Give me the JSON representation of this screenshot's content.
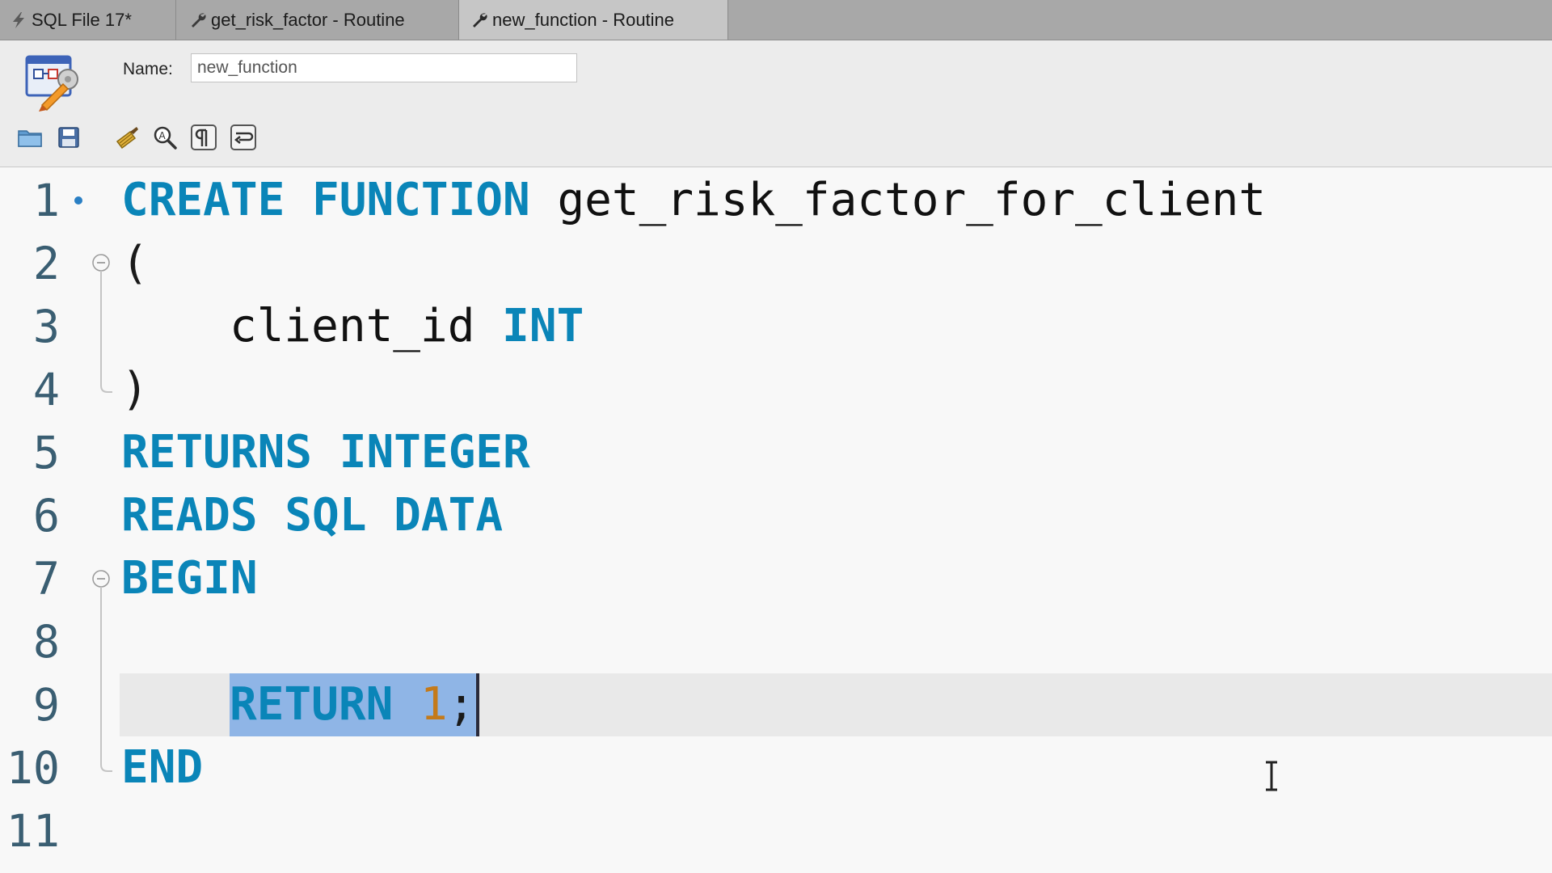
{
  "tabs": [
    {
      "label": "SQL File 17*",
      "icon": "lightning-icon",
      "active": false
    },
    {
      "label": "get_risk_factor - Routine",
      "icon": "wrench-icon",
      "active": false
    },
    {
      "label": "new_function - Routine",
      "icon": "wrench-icon",
      "active": true
    }
  ],
  "header": {
    "name_label": "Name:",
    "name_value": "new_function",
    "toolbar": [
      "open-folder-icon",
      "save-icon",
      "beautify-brush-icon",
      "find-icon",
      "invisible-chars-icon",
      "word-wrap-icon"
    ]
  },
  "editor": {
    "line_numbers": [
      "1",
      "2",
      "3",
      "4",
      "5",
      "6",
      "7",
      "8",
      "9",
      "10",
      "11"
    ],
    "lines": {
      "l1": {
        "kw1": "CREATE",
        "kw2": "FUNCTION",
        "ident": "get_risk_factor_for_client"
      },
      "l2": {
        "punct": "("
      },
      "l3": {
        "ident": "client_id",
        "kw": "INT"
      },
      "l4": {
        "punct": ")"
      },
      "l5": {
        "kw1": "RETURNS",
        "kw2": "INTEGER"
      },
      "l6": {
        "kw1": "READS",
        "kw2": "SQL",
        "kw3": "DATA"
      },
      "l7": {
        "kw": "BEGIN"
      },
      "l9": {
        "kw": "RETURN",
        "num": "1",
        "punct": ";"
      },
      "l10": {
        "kw": "END"
      }
    },
    "current_line": "9",
    "selected_text": "RETURN 1;"
  },
  "colors": {
    "keyword": "#0a85b8",
    "number": "#c47a1a",
    "line_number": "#3a5e72",
    "selection": "#8fb5e6",
    "current_line": "#e9e9e9",
    "tabbar": "#a8a8a8",
    "active_tab": "#c6c6c6"
  }
}
